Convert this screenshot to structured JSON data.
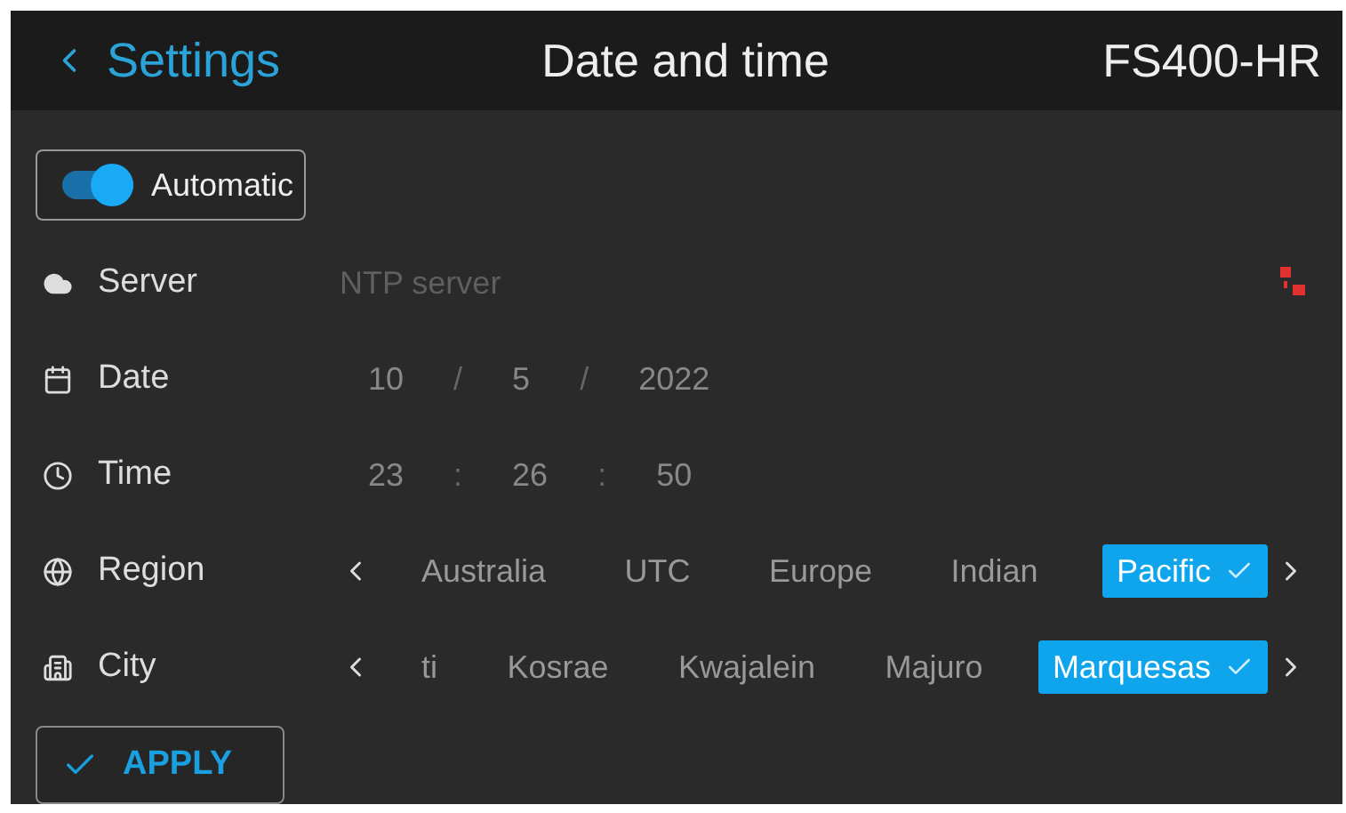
{
  "header": {
    "back_label": "Settings",
    "title": "Date and time",
    "device": "FS400-HR"
  },
  "automatic": {
    "label": "Automatic",
    "on": true
  },
  "rows": [
    {
      "kind": "text",
      "label": "Server",
      "placeholder": "NTP server",
      "connected": false
    },
    {
      "kind": "segments",
      "label": "Date",
      "parts": [
        "10",
        "5",
        "2022"
      ],
      "separator": "/"
    },
    {
      "kind": "segments",
      "label": "Time",
      "parts": [
        "23",
        "26",
        "50"
      ],
      "separator": ":"
    },
    {
      "kind": "picker",
      "label": "Region",
      "options": [
        {
          "label": "Australia",
          "selected": false
        },
        {
          "label": "UTC",
          "selected": false
        },
        {
          "label": "Europe",
          "selected": false
        },
        {
          "label": "Indian",
          "selected": false
        },
        {
          "label": "Pacific",
          "selected": true
        }
      ]
    },
    {
      "kind": "picker",
      "label": "City",
      "options": [
        {
          "label": "ti",
          "selected": false
        },
        {
          "label": "Kosrae",
          "selected": false
        },
        {
          "label": "Kwajalein",
          "selected": false
        },
        {
          "label": "Majuro",
          "selected": false
        },
        {
          "label": "Marquesas",
          "selected": true
        }
      ]
    }
  ],
  "apply": {
    "label": "APPLY"
  }
}
